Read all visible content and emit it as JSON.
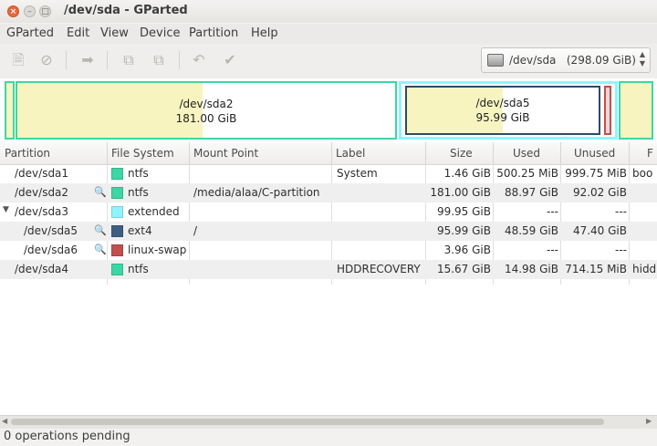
{
  "window": {
    "title": "/dev/sda - GParted"
  },
  "menubar": [
    "GParted",
    "Edit",
    "View",
    "Device",
    "Partition",
    "Help"
  ],
  "toolbar": {
    "icons": [
      "new-icon",
      "delete-icon",
      "resize-move-icon",
      "copy-icon",
      "paste-icon",
      "undo-icon",
      "apply-icon"
    ]
  },
  "device": {
    "name": "/dev/sda",
    "size": "(298.09 GiB)"
  },
  "diskmap": {
    "sda2": {
      "name": "/dev/sda2",
      "size": "181.00 GiB",
      "used_fraction": 0.49
    },
    "sda5": {
      "name": "/dev/sda5",
      "size": "95.99 GiB",
      "used_fraction": 0.5
    }
  },
  "table": {
    "headers": [
      "Partition",
      "File System",
      "Mount Point",
      "Label",
      "Size",
      "Used",
      "Unused",
      "F"
    ],
    "rows": [
      {
        "partition": "/dev/sda1",
        "fs": "ntfs",
        "fs_color": "#3dd6a5",
        "mount": "",
        "label": "System",
        "size": "1.46 GiB",
        "used": "500.25 MiB",
        "unused": "999.75 MiB",
        "flags": "boo"
      },
      {
        "partition": "/dev/sda2",
        "fs": "ntfs",
        "fs_color": "#3dd6a5",
        "mount": "/media/alaa/C-partition",
        "label": "",
        "size": "181.00 GiB",
        "used": "88.97 GiB",
        "unused": "92.02 GiB",
        "flags": ""
      },
      {
        "partition": "/dev/sda3",
        "fs": "extended",
        "fs_color": "#8ff4ff",
        "mount": "",
        "label": "",
        "size": "99.95 GiB",
        "used": "---",
        "unused": "---",
        "flags": ""
      },
      {
        "partition": "/dev/sda5",
        "fs": "ext4",
        "fs_color": "#3e5f82",
        "mount": "/",
        "label": "",
        "size": "95.99 GiB",
        "used": "48.59 GiB",
        "unused": "47.40 GiB",
        "flags": ""
      },
      {
        "partition": "/dev/sda6",
        "fs": "linux-swap",
        "fs_color": "#c0504d",
        "mount": "",
        "label": "",
        "size": "3.96 GiB",
        "used": "---",
        "unused": "---",
        "flags": ""
      },
      {
        "partition": "/dev/sda4",
        "fs": "ntfs",
        "fs_color": "#3dd6a5",
        "mount": "",
        "label": "HDDRECOVERY",
        "size": "15.67 GiB",
        "used": "14.98 GiB",
        "unused": "714.15 MiB",
        "flags": "hidd"
      }
    ]
  },
  "status": {
    "text": "0 operations pending"
  }
}
